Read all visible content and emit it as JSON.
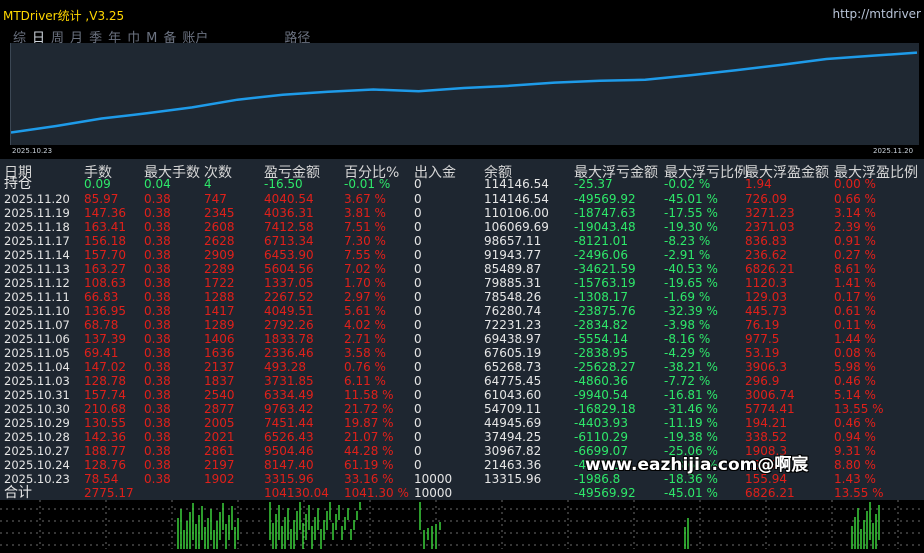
{
  "window": {
    "title": "MTDriver统计 ,V3.25",
    "url": "http://mtdriver"
  },
  "tabs": [
    {
      "label": "综"
    },
    {
      "label": "日"
    },
    {
      "label": "周"
    },
    {
      "label": "月"
    },
    {
      "label": "季"
    },
    {
      "label": "年"
    },
    {
      "label": "巾"
    },
    {
      "label": "M"
    },
    {
      "label": "备"
    },
    {
      "label": "账户"
    },
    {
      "label": "路径"
    }
  ],
  "active_tab": "日",
  "equity_chart": {
    "start_label": "2025.10.23",
    "end_label": "2025.11.20",
    "line_color": "#1e9be9",
    "dates": [
      "2025.10.23",
      "2025.10.24",
      "2025.10.27",
      "2025.10.28",
      "2025.10.29",
      "2025.10.30",
      "2025.10.31",
      "2025.11.03",
      "2025.11.04",
      "2025.11.05",
      "2025.11.06",
      "2025.11.07",
      "2025.11.10",
      "2025.11.11",
      "2025.11.12",
      "2025.11.13",
      "2025.11.14",
      "2025.11.17",
      "2025.11.18",
      "2025.11.19",
      "2025.11.20"
    ],
    "balances": [
      13315.96,
      21463.36,
      30967.82,
      37494.25,
      44945.69,
      54709.11,
      61043.6,
      64775.45,
      67605.19,
      65268.73,
      69438.97,
      72231.23,
      76280.74,
      78548.26,
      79885.31,
      85489.87,
      91943.77,
      98657.11,
      106069.69,
      110106.0,
      114146.54
    ]
  },
  "table": {
    "headers": [
      "日期",
      "手数",
      "最大手数",
      "次数",
      "盈亏金额",
      "百分比%",
      "出入金",
      "余额",
      "最大浮亏金额",
      "最大浮亏比例",
      "最大浮盈金额",
      "最大浮盈比例"
    ],
    "holding": {
      "date": "持仓",
      "lots": "0.09",
      "max_lots": "0.04",
      "count": "4",
      "pnl": "-16.50",
      "pct": "-0.01 %",
      "io": "0",
      "balance": "114146.54",
      "max_float_loss": "-25.37",
      "max_float_loss_pct": "-0.02 %",
      "max_float_profit": "1.94",
      "max_float_profit_pct": "0.00 %"
    },
    "rows": [
      {
        "date": "2025.11.20",
        "lots": "85.97",
        "max_lots": "0.38",
        "count": "747",
        "pnl": "4040.54",
        "pct": "3.67 %",
        "io": "0",
        "balance": "114146.54",
        "max_float_loss": "-49569.92",
        "max_float_loss_pct": "-45.01 %",
        "max_float_profit": "726.09",
        "max_float_profit_pct": "0.66 %"
      },
      {
        "date": "2025.11.19",
        "lots": "147.36",
        "max_lots": "0.38",
        "count": "2345",
        "pnl": "4036.31",
        "pct": "3.81 %",
        "io": "0",
        "balance": "110106.00",
        "max_float_loss": "-18747.63",
        "max_float_loss_pct": "-17.55 %",
        "max_float_profit": "3271.23",
        "max_float_profit_pct": "3.14 %"
      },
      {
        "date": "2025.11.18",
        "lots": "163.41",
        "max_lots": "0.38",
        "count": "2608",
        "pnl": "7412.58",
        "pct": "7.51 %",
        "io": "0",
        "balance": "106069.69",
        "max_float_loss": "-19043.48",
        "max_float_loss_pct": "-19.30 %",
        "max_float_profit": "2371.03",
        "max_float_profit_pct": "2.39 %"
      },
      {
        "date": "2025.11.17",
        "lots": "156.18",
        "max_lots": "0.38",
        "count": "2628",
        "pnl": "6713.34",
        "pct": "7.30 %",
        "io": "0",
        "balance": "98657.11",
        "max_float_loss": "-8121.01",
        "max_float_loss_pct": "-8.23 %",
        "max_float_profit": "836.83",
        "max_float_profit_pct": "0.91 %"
      },
      {
        "date": "2025.11.14",
        "lots": "157.70",
        "max_lots": "0.38",
        "count": "2909",
        "pnl": "6453.90",
        "pct": "7.55 %",
        "io": "0",
        "balance": "91943.77",
        "max_float_loss": "-2496.06",
        "max_float_loss_pct": "-2.91 %",
        "max_float_profit": "236.62",
        "max_float_profit_pct": "0.27 %"
      },
      {
        "date": "2025.11.13",
        "lots": "163.27",
        "max_lots": "0.38",
        "count": "2289",
        "pnl": "5604.56",
        "pct": "7.02 %",
        "io": "0",
        "balance": "85489.87",
        "max_float_loss": "-34621.59",
        "max_float_loss_pct": "-40.53 %",
        "max_float_profit": "6826.21",
        "max_float_profit_pct": "8.61 %"
      },
      {
        "date": "2025.11.12",
        "lots": "108.63",
        "max_lots": "0.38",
        "count": "1722",
        "pnl": "1337.05",
        "pct": "1.70 %",
        "io": "0",
        "balance": "79885.31",
        "max_float_loss": "-15763.19",
        "max_float_loss_pct": "-19.65 %",
        "max_float_profit": "1120.3",
        "max_float_profit_pct": "1.41 %"
      },
      {
        "date": "2025.11.11",
        "lots": "66.83",
        "max_lots": "0.38",
        "count": "1288",
        "pnl": "2267.52",
        "pct": "2.97 %",
        "io": "0",
        "balance": "78548.26",
        "max_float_loss": "-1308.17",
        "max_float_loss_pct": "-1.69 %",
        "max_float_profit": "129.03",
        "max_float_profit_pct": "0.17 %"
      },
      {
        "date": "2025.11.10",
        "lots": "136.95",
        "max_lots": "0.38",
        "count": "1417",
        "pnl": "4049.51",
        "pct": "5.61 %",
        "io": "0",
        "balance": "76280.74",
        "max_float_loss": "-23875.76",
        "max_float_loss_pct": "-32.39 %",
        "max_float_profit": "445.73",
        "max_float_profit_pct": "0.61 %"
      },
      {
        "date": "2025.11.07",
        "lots": "68.78",
        "max_lots": "0.38",
        "count": "1289",
        "pnl": "2792.26",
        "pct": "4.02 %",
        "io": "0",
        "balance": "72231.23",
        "max_float_loss": "-2834.82",
        "max_float_loss_pct": "-3.98 %",
        "max_float_profit": "76.19",
        "max_float_profit_pct": "0.11 %"
      },
      {
        "date": "2025.11.06",
        "lots": "137.39",
        "max_lots": "0.38",
        "count": "1406",
        "pnl": "1833.78",
        "pct": "2.71 %",
        "io": "0",
        "balance": "69438.97",
        "max_float_loss": "-5554.14",
        "max_float_loss_pct": "-8.16 %",
        "max_float_profit": "977.5",
        "max_float_profit_pct": "1.44 %"
      },
      {
        "date": "2025.11.05",
        "lots": "69.41",
        "max_lots": "0.38",
        "count": "1636",
        "pnl": "2336.46",
        "pct": "3.58 %",
        "io": "0",
        "balance": "67605.19",
        "max_float_loss": "-2838.95",
        "max_float_loss_pct": "-4.29 %",
        "max_float_profit": "53.19",
        "max_float_profit_pct": "0.08 %"
      },
      {
        "date": "2025.11.04",
        "lots": "147.02",
        "max_lots": "0.38",
        "count": "2137",
        "pnl": "493.28",
        "pct": "0.76 %",
        "io": "0",
        "balance": "65268.73",
        "max_float_loss": "-25628.27",
        "max_float_loss_pct": "-38.21 %",
        "max_float_profit": "3906.3",
        "max_float_profit_pct": "5.98 %"
      },
      {
        "date": "2025.11.03",
        "lots": "128.78",
        "max_lots": "0.38",
        "count": "1837",
        "pnl": "3731.85",
        "pct": "6.11 %",
        "io": "0",
        "balance": "64775.45",
        "max_float_loss": "-4860.36",
        "max_float_loss_pct": "-7.72 %",
        "max_float_profit": "296.9",
        "max_float_profit_pct": "0.46 %"
      },
      {
        "date": "2025.10.31",
        "lots": "157.74",
        "max_lots": "0.38",
        "count": "2540",
        "pnl": "6334.49",
        "pct": "11.58 %",
        "io": "0",
        "balance": "61043.60",
        "max_float_loss": "-9940.54",
        "max_float_loss_pct": "-16.81 %",
        "max_float_profit": "3006.74",
        "max_float_profit_pct": "5.14 %"
      },
      {
        "date": "2025.10.30",
        "lots": "210.68",
        "max_lots": "0.38",
        "count": "2877",
        "pnl": "9763.42",
        "pct": "21.72 %",
        "io": "0",
        "balance": "54709.11",
        "max_float_loss": "-16829.18",
        "max_float_loss_pct": "-31.46 %",
        "max_float_profit": "5774.41",
        "max_float_profit_pct": "13.55 %"
      },
      {
        "date": "2025.10.29",
        "lots": "130.55",
        "max_lots": "0.38",
        "count": "2005",
        "pnl": "7451.44",
        "pct": "19.87 %",
        "io": "0",
        "balance": "44945.69",
        "max_float_loss": "-4403.93",
        "max_float_loss_pct": "-11.19 %",
        "max_float_profit": "194.21",
        "max_float_profit_pct": "0.46 %"
      },
      {
        "date": "2025.10.28",
        "lots": "142.36",
        "max_lots": "0.38",
        "count": "2021",
        "pnl": "6526.43",
        "pct": "21.07 %",
        "io": "0",
        "balance": "37494.25",
        "max_float_loss": "-6110.29",
        "max_float_loss_pct": "-19.38 %",
        "max_float_profit": "338.52",
        "max_float_profit_pct": "0.94 %"
      },
      {
        "date": "2025.10.27",
        "lots": "188.77",
        "max_lots": "0.38",
        "count": "2861",
        "pnl": "9504.46",
        "pct": "44.28 %",
        "io": "0",
        "balance": "30967.82",
        "max_float_loss": "-6699.07",
        "max_float_loss_pct": "-25.06 %",
        "max_float_profit": "1908.3",
        "max_float_profit_pct": "9.31 %"
      },
      {
        "date": "2025.10.24",
        "lots": "128.76",
        "max_lots": "0.38",
        "count": "2197",
        "pnl": "8147.40",
        "pct": "61.19 %",
        "io": "0",
        "balance": "21463.36",
        "max_float_loss": "-4811.67",
        "max_float_loss_pct": "-23.61 %",
        "max_float_profit": "1886.9",
        "max_float_profit_pct": "8.80 %"
      },
      {
        "date": "2025.10.23",
        "lots": "78.54",
        "max_lots": "0.38",
        "count": "1902",
        "pnl": "3315.96",
        "pct": "33.16 %",
        "io": "10000",
        "balance": "13315.96",
        "max_float_loss": "-1986.8",
        "max_float_loss_pct": "-18.36 %",
        "max_float_profit": "155.94",
        "max_float_profit_pct": "1.43 %"
      }
    ],
    "total": {
      "date": "合计",
      "lots": "2775.17",
      "max_lots": "",
      "count": "",
      "pnl": "104130.04",
      "pct": "1041.30 %",
      "io": "10000",
      "balance": "",
      "max_float_loss": "-49569.92",
      "max_float_loss_pct": "-45.01 %",
      "max_float_profit": "6826.21",
      "max_float_profit_pct": "13.55 %"
    }
  },
  "watermark": "www.eazhijia.com@啊宸",
  "colors": {
    "profit": "#e0201a",
    "loss": "#2ee86a",
    "neutral": "#e6e6e6",
    "title": "#ffd700",
    "bar": "#3ad13a"
  }
}
